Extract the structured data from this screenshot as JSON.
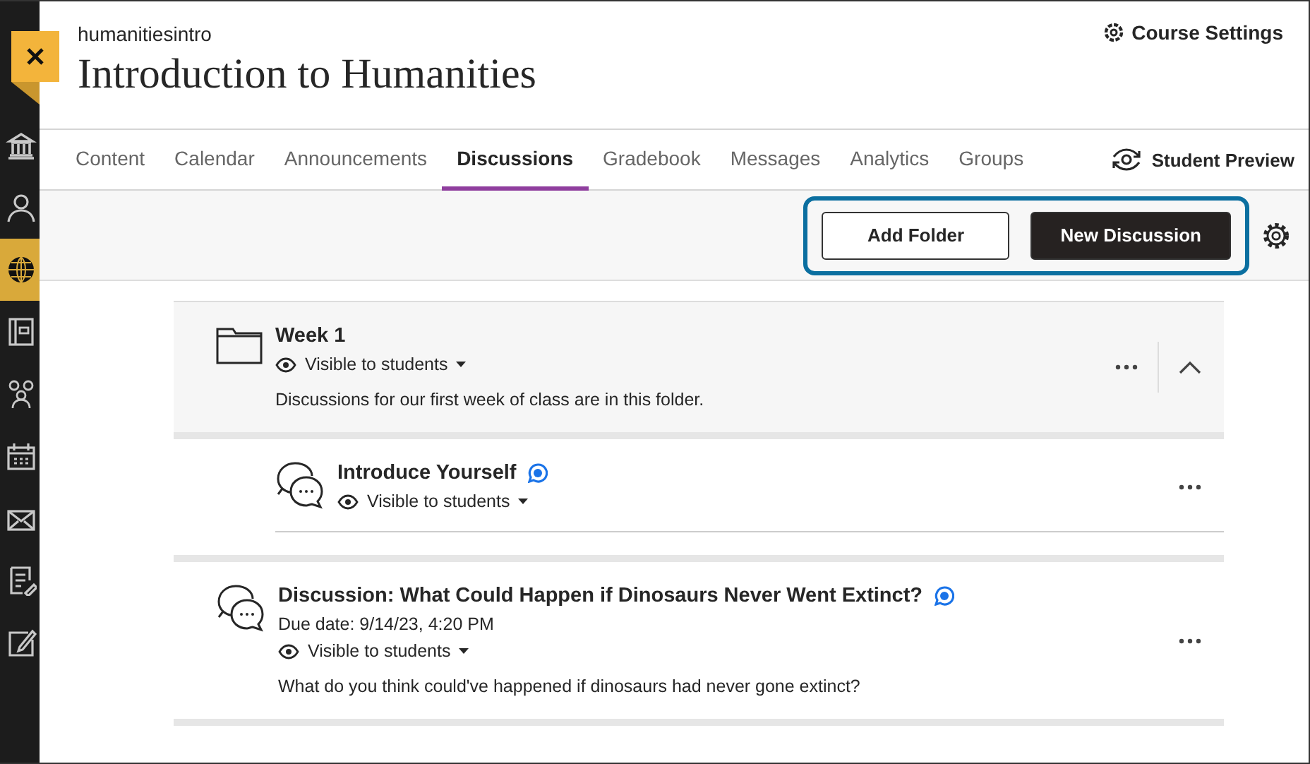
{
  "sidebar": {
    "items": [
      {
        "kind": "institution",
        "selected": false
      },
      {
        "kind": "person",
        "selected": false
      },
      {
        "kind": "globe",
        "selected": true
      },
      {
        "kind": "book",
        "selected": false
      },
      {
        "kind": "people",
        "selected": false
      },
      {
        "kind": "calendar",
        "selected": false
      },
      {
        "kind": "mail",
        "selected": false
      },
      {
        "kind": "grades",
        "selected": false
      },
      {
        "kind": "edit",
        "selected": false
      }
    ]
  },
  "header": {
    "course_code": "humanitiesintro",
    "title": "Introduction to Humanities",
    "settings_link": "Course Settings"
  },
  "tabs": [
    {
      "label": "Content",
      "selected": false
    },
    {
      "label": "Calendar",
      "selected": false
    },
    {
      "label": "Announcements",
      "selected": false
    },
    {
      "label": "Discussions",
      "selected": true
    },
    {
      "label": "Gradebook",
      "selected": false
    },
    {
      "label": "Messages",
      "selected": false
    },
    {
      "label": "Analytics",
      "selected": false
    },
    {
      "label": "Groups",
      "selected": false
    }
  ],
  "student_preview": "Student Preview",
  "toolbar": {
    "buttons": [
      {
        "label": "Add Folder",
        "kind": "secondary"
      },
      {
        "label": "New Discussion",
        "kind": "primary"
      }
    ],
    "highlighted": true
  },
  "items": [
    {
      "kind": "folder",
      "title": "Week 1",
      "visibility": "Visible to students",
      "description": "Discussions for our first week of class are in this folder.",
      "expanded": true,
      "new_activity": false,
      "children": [
        {
          "kind": "discussion",
          "title": "Introduce Yourself",
          "visibility": "Visible to students",
          "new_activity": true
        }
      ]
    },
    {
      "kind": "discussion",
      "title": "Discussion: What Could Happen if Dinosaurs Never Went Extinct?",
      "due": "Due date: 9/14/23, 4:20 PM",
      "visibility": "Visible to students",
      "description": "What do you think could've happened if dinosaurs had never gone extinct?",
      "new_activity": true
    }
  ]
}
